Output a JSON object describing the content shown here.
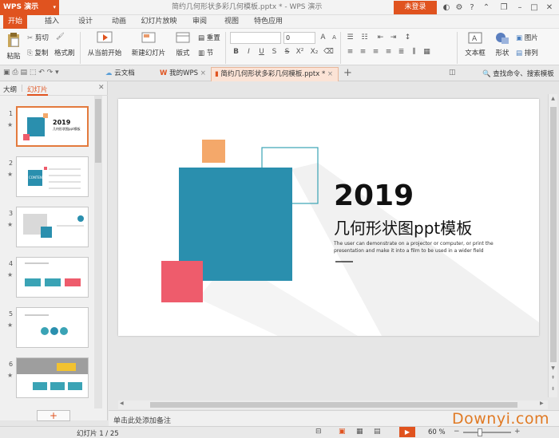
{
  "app": {
    "name": "WPS 演示",
    "doc_title": "简约几何形状多彩几何模板.pptx * - WPS 演示",
    "login": "未登录"
  },
  "menu_tabs": [
    "开始",
    "插入",
    "设计",
    "动画",
    "幻灯片放映",
    "审阅",
    "视图",
    "特色应用"
  ],
  "ribbon": {
    "paste": "粘贴",
    "cut": "剪切",
    "copy": "复制",
    "format_painter": "格式刷",
    "from_current": "从当前开始",
    "new_slide": "新建幻灯片",
    "layout": "版式",
    "reset": "重置",
    "section": "节",
    "font_size": "0",
    "text_box": "文本框",
    "shape": "形状",
    "picture": "图片",
    "arrange": "排列"
  },
  "tabbar": {
    "cloud_doc": "云文档",
    "my_wps": "我的WPS",
    "active_doc": "简约几何形状多彩几何模板.pptx *",
    "search": "查找命令、搜索模板"
  },
  "panel": {
    "outline_tab": "大纲",
    "slides_tab": "幻灯片",
    "add_button": "+"
  },
  "thumbnails": [
    {
      "num": "1",
      "title": "2019",
      "subtitle": "几何形状图ppt模板"
    },
    {
      "num": "2",
      "title": "CONTENT"
    },
    {
      "num": "3"
    },
    {
      "num": "4"
    },
    {
      "num": "5"
    },
    {
      "num": "6"
    }
  ],
  "slide": {
    "year": "2019",
    "title": "几何形状图ppt模板",
    "desc1": "The user can demonstrate on a projector or computer, or print the",
    "desc2": "presentation and make it into a film to be used in a wider field",
    "colors": {
      "teal": "#2a8fae",
      "orange": "#f4a86a",
      "pink": "#ee5c6c",
      "outline": "#3aa3b5"
    }
  },
  "notes": "单击此处添加备注",
  "status": {
    "slide_counter": "幻灯片 1 / 25",
    "zoom": "60 %"
  },
  "watermark": "Downyi.com",
  "colors": {
    "accent": "#e0531f",
    "selected_border": "#e37a3d"
  }
}
